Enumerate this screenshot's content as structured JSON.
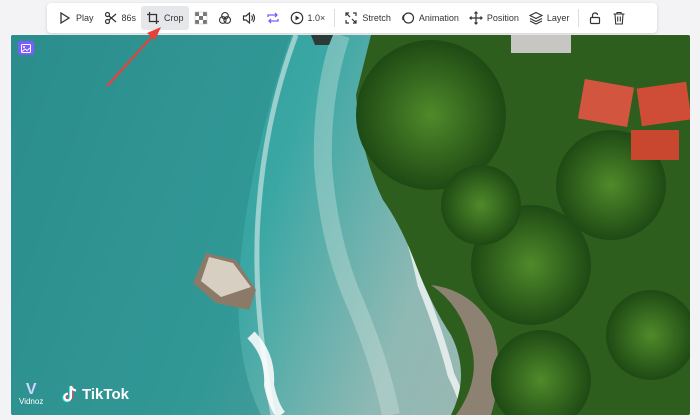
{
  "toolbar": {
    "play_label": "Play",
    "duration_label": "86s",
    "crop_label": "Crop",
    "speed_label": "1.0×",
    "stretch_label": "Stretch",
    "animation_label": "Animation",
    "position_label": "Position",
    "layer_label": "Layer"
  },
  "canvas": {
    "watermark_label": "Vidnoz",
    "watermark_glyph": "V",
    "social_label": "TikTok"
  },
  "colors": {
    "accent": "#7b5cff",
    "annotation_arrow": "#e8403a"
  },
  "icons": [
    "play-icon",
    "scissors-icon",
    "crop-icon",
    "transparency-icon",
    "filter-icon",
    "volume-icon",
    "loop-icon",
    "speed-icon",
    "stretch-icon",
    "animation-icon",
    "position-icon",
    "layer-icon",
    "lock-icon",
    "delete-icon"
  ]
}
